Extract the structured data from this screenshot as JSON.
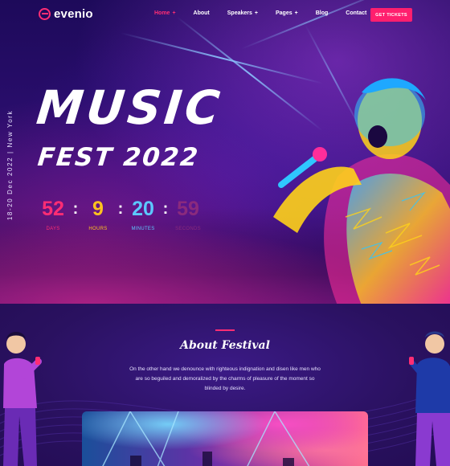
{
  "brand": {
    "name": "evenio",
    "color": "#ff2d74"
  },
  "nav": {
    "items": [
      {
        "label": "Home",
        "has_plus": true,
        "active": true
      },
      {
        "label": "About",
        "has_plus": false,
        "active": false
      },
      {
        "label": "Speakers",
        "has_plus": true,
        "active": false
      },
      {
        "label": "Pages",
        "has_plus": true,
        "active": false
      },
      {
        "label": "Blog",
        "has_plus": false,
        "active": false
      },
      {
        "label": "Contact",
        "has_plus": false,
        "active": false
      }
    ],
    "cta_label": "GET TICKETS"
  },
  "hero": {
    "side_text": "18-20 Dec 2022 | New York",
    "title_line1": "MUSIC",
    "title_line2": "FEST 2022",
    "countdown": [
      {
        "value": "52",
        "label": "DAYS",
        "color": "#ff2d74"
      },
      {
        "value": "9",
        "label": "HOURS",
        "color": "#ffc21f"
      },
      {
        "value": "20",
        "label": "MINUTES",
        "color": "#5cc8ff"
      },
      {
        "value": "59",
        "label": "SECONDS",
        "color": "#8a2a7d"
      }
    ]
  },
  "about": {
    "title": "About Festival",
    "text": "On the other hand we denounce with righteous indignation and disen like men who are so beguiled and demoralized by the charms of pleasure of the moment so blinded by desire."
  },
  "colors": {
    "accent": "#ff1f6e",
    "background": "#2a1160"
  }
}
